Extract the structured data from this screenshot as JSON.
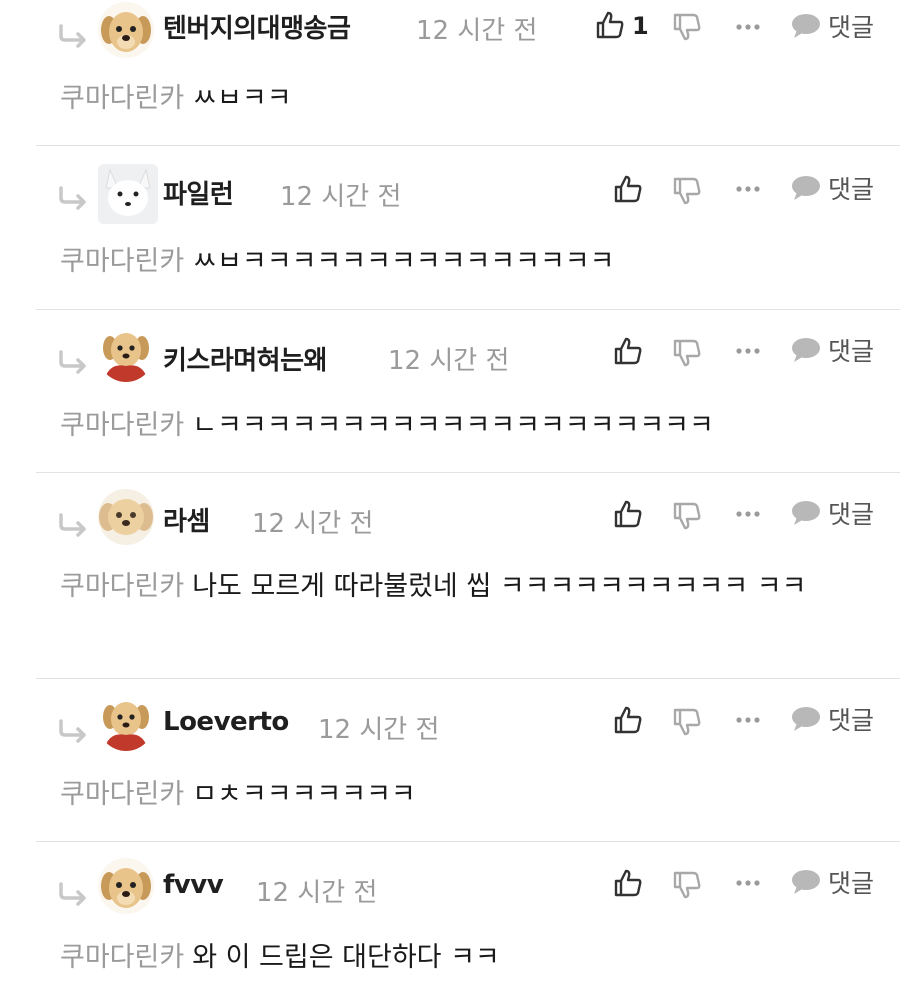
{
  "comments": [
    {
      "author": "텐버지의대맹송금",
      "time": "12 시간 전",
      "mention": "쿠마다린카",
      "text": "ㅆㅂㅋㅋ",
      "likes": "1",
      "avatar": "puppy",
      "reply_label": "댓글"
    },
    {
      "author": "파일런",
      "time": "12 시간 전",
      "mention": "쿠마다린카",
      "text": "ㅆㅂㅋㅋㅋㅋㅋㅋㅋㅋㅋㅋㅋㅋㅋㅋㅋ",
      "likes": "",
      "avatar": "white-fox",
      "reply_label": "댓글"
    },
    {
      "author": "키스라며혀는왜",
      "time": "12 시간 전",
      "mention": "쿠마다린카",
      "text": "ㄴㅋㅋㅋㅋㅋㅋㅋㅋㅋㅋㅋㅋㅋㅋㅋㅋㅋㅋㅋㅋ",
      "likes": "",
      "avatar": "puppy-red-cloth",
      "reply_label": "댓글"
    },
    {
      "author": "라셈",
      "time": "12 시간 전",
      "mention": "쿠마다린카",
      "text": "나도 모르게 따라불렀네 씹 ㅋㅋㅋㅋㅋㅋㅋㅋㅋㅋ ㅋㅋ",
      "likes": "",
      "avatar": "puppy-blur",
      "reply_label": "댓글"
    },
    {
      "author": "Loeverto",
      "time": "12 시간 전",
      "mention": "쿠마다린카",
      "text": "ㅁㅊㅋㅋㅋㅋㅋㅋㅋ",
      "likes": "",
      "avatar": "puppy-red-cloth",
      "reply_label": "댓글"
    },
    {
      "author": "fvvv",
      "time": "12 시간 전",
      "mention": "쿠마다린카",
      "text": "와 이 드립은 대단하다 ㅋㅋ",
      "likes": "",
      "avatar": "puppy",
      "reply_label": "댓글"
    }
  ],
  "colors": {
    "author": "#1f1f1f",
    "time": "#9a9a9a",
    "mention": "#9b9b9b",
    "icon": "#333333",
    "icon_muted": "#9a9a9a",
    "divider": "#e3e3e3"
  }
}
